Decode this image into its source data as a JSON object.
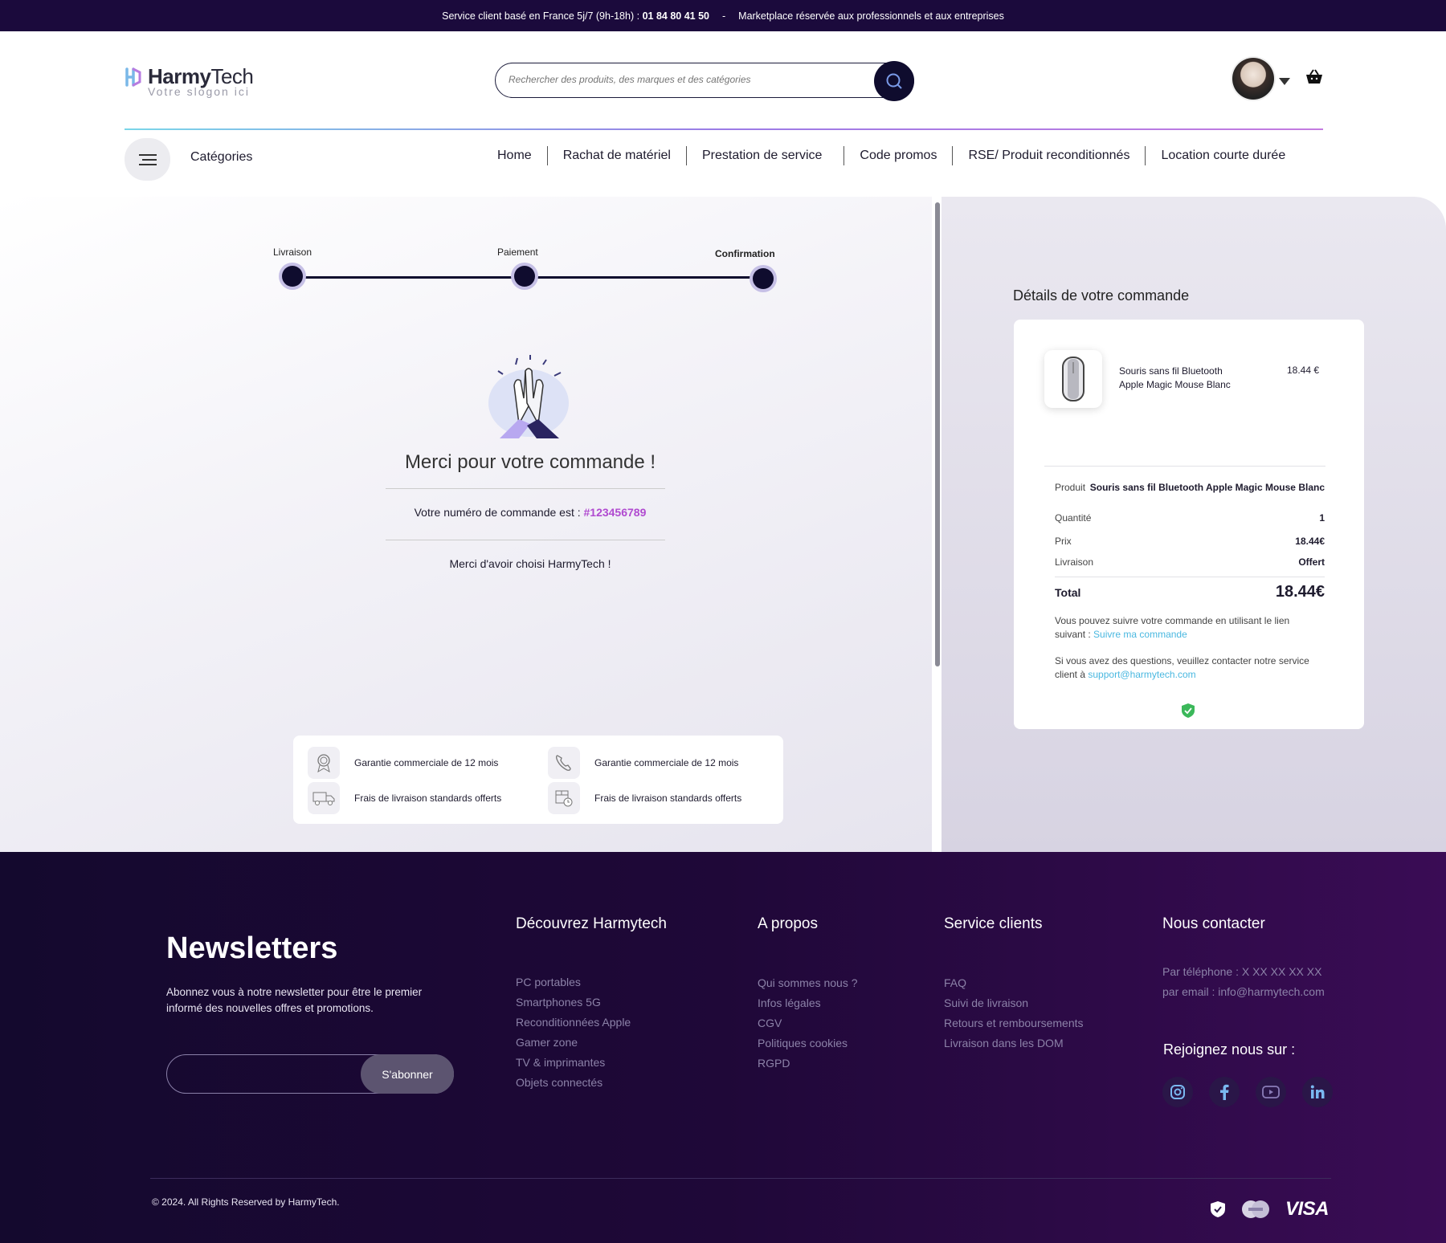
{
  "topbar": {
    "service_prefix": "Service client basé en France 5j/7 (9h-18h) :",
    "phone": "01 84 80 41 50",
    "dash": "-",
    "marketplace": "Marketplace réservée aux professionnels et aux entreprises"
  },
  "header": {
    "logo_bold": "Harmy",
    "logo_regular": "Tech",
    "slogan": "Votre slogon ici",
    "search_placeholder": "Rechercher des produits, des marques et des catégories"
  },
  "nav": {
    "categories_label": "Catégories",
    "items": [
      "Home",
      "Rachat de matériel",
      "Prestation de service",
      "Code promos",
      "RSE/ Produit reconditionnés",
      "Location courte durée"
    ]
  },
  "stepper": {
    "steps": [
      "Livraison",
      "Paiement",
      "Confirmation"
    ],
    "active_index": 2
  },
  "confirmation": {
    "title": "Merci pour votre commande !",
    "order_prefix": "Votre numéro de commande est :",
    "order_number": "#123456789",
    "thanks": "Merci d'avoir choisi HarmyTech !"
  },
  "guarantees": [
    {
      "label": "Garantie commerciale de 12 mois",
      "icon": "award-ribbon-icon"
    },
    {
      "label": "Garantie commerciale de 12 mois",
      "icon": "phone-support-icon"
    },
    {
      "label": "Frais de livraison standards offerts",
      "icon": "delivery-truck-icon"
    },
    {
      "label": "Frais de livraison standards offerts",
      "icon": "package-clock-icon"
    }
  ],
  "order": {
    "title": "Détails de votre commande",
    "product_name_line1": "Souris sans fil Bluetooth",
    "product_name_line2": "Apple Magic Mouse Blanc",
    "product_price": "18.44 €",
    "rows": {
      "produit_label": "Produit",
      "produit_value": "Souris sans fil Bluetooth Apple Magic Mouse Blanc",
      "quantite_label": "Quantité",
      "quantite_value": "1",
      "prix_label": "Prix",
      "prix_value": "18.44€",
      "livraison_label": "Livraison",
      "livraison_value": "Offert",
      "total_label": "Total",
      "total_value": "18.44€"
    },
    "track_text_1": "Vous pouvez suivre votre commande en utilisant le lien",
    "track_text_2": "suivant :",
    "track_link": "Suivre ma commande",
    "support_text_1": "Si vous avez des questions, veuillez contacter notre service",
    "support_text_2": "client à",
    "support_email": "support@harmytech.com"
  },
  "footer": {
    "newsletter_title": "Newsletters",
    "newsletter_text": "Abonnez vous à notre newsletter pour être le premier informé des nouvelles offres et promotions.",
    "subscribe_label": "S'abonner",
    "col1_title": "Découvrez Harmytech",
    "col1_links": [
      "PC portables",
      "Smartphones 5G",
      "Reconditionnées Apple",
      "Gamer zone",
      "TV & imprimantes",
      "Objets connectés"
    ],
    "col2_title": "A propos",
    "col2_links": [
      "Qui sommes nous ?",
      "Infos légales",
      "CGV",
      "Politiques cookies",
      "RGPD"
    ],
    "col3_title": "Service clients",
    "col3_links": [
      "FAQ",
      "Suivi de livraison",
      "Retours et remboursements",
      "Livraison dans les DOM"
    ],
    "col4_title": "Nous contacter",
    "contact_phone": "Par téléphone : X XX XX XX XX",
    "contact_email": "par email : info@harmytech.com",
    "join_title": "Rejoignez nous sur :",
    "copyright": "© 2024. All Rights Reserved by HarmyTech.",
    "visa": "VISA"
  },
  "colors": {
    "topbar": "#1b0a3c",
    "accent_order": "#b04ad0",
    "link": "#4ab8e0",
    "dark": "#0f0c2e"
  }
}
